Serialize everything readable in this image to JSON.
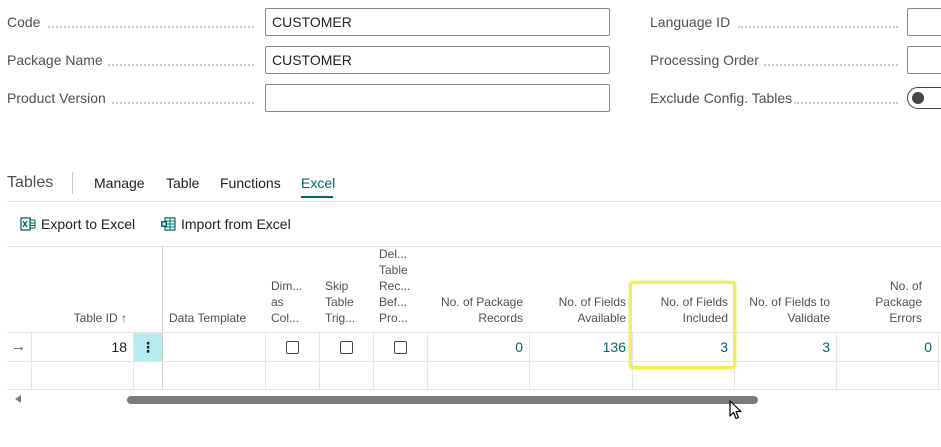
{
  "form": {
    "code_label": "Code",
    "code_value": "CUSTOMER",
    "package_name_label": "Package Name",
    "package_name_value": "CUSTOMER",
    "product_version_label": "Product Version",
    "product_version_value": "",
    "language_id_label": "Language ID",
    "language_id_value": "",
    "processing_order_label": "Processing Order",
    "processing_order_value": "",
    "exclude_config_label": "Exclude Config. Tables",
    "exclude_config_on": false
  },
  "tables_section": {
    "title": "Tables",
    "tabs": [
      {
        "label": "Manage",
        "active": false
      },
      {
        "label": "Table",
        "active": false
      },
      {
        "label": "Functions",
        "active": false
      },
      {
        "label": "Excel",
        "active": true
      }
    ],
    "actions": [
      {
        "label": "Export to Excel",
        "icon": "excel-export-icon"
      },
      {
        "label": "Import from Excel",
        "icon": "excel-import-icon"
      }
    ]
  },
  "grid": {
    "headers": {
      "table_id": "Table ID ↑",
      "data_template": "Data Template",
      "dim_as_columns": "Dim... as Col...",
      "skip_table_triggers": "Skip Table Trig...",
      "delete_table_records": "Del... Table Rec... Bef... Pro...",
      "no_package_records": "No. of Package Records",
      "no_fields_available": "No. of Fields Available",
      "no_fields_included": "No. of Fields Included",
      "no_fields_to_validate": "No. of Fields to Validate",
      "no_package_errors": "No. of Package Errors"
    },
    "row": {
      "indicator": "→",
      "table_id": "18",
      "menu": "⋮",
      "data_template": "",
      "dim_as_columns": false,
      "skip_table_triggers": false,
      "delete_table_records": false,
      "no_package_records": "0",
      "no_fields_available": "136",
      "no_fields_included": "3",
      "no_fields_to_validate": "3",
      "no_package_errors": "0"
    }
  },
  "colors": {
    "accent": "#00676b",
    "highlight": "#f2f04f",
    "menu_cell_bg": "#b7ecee"
  }
}
